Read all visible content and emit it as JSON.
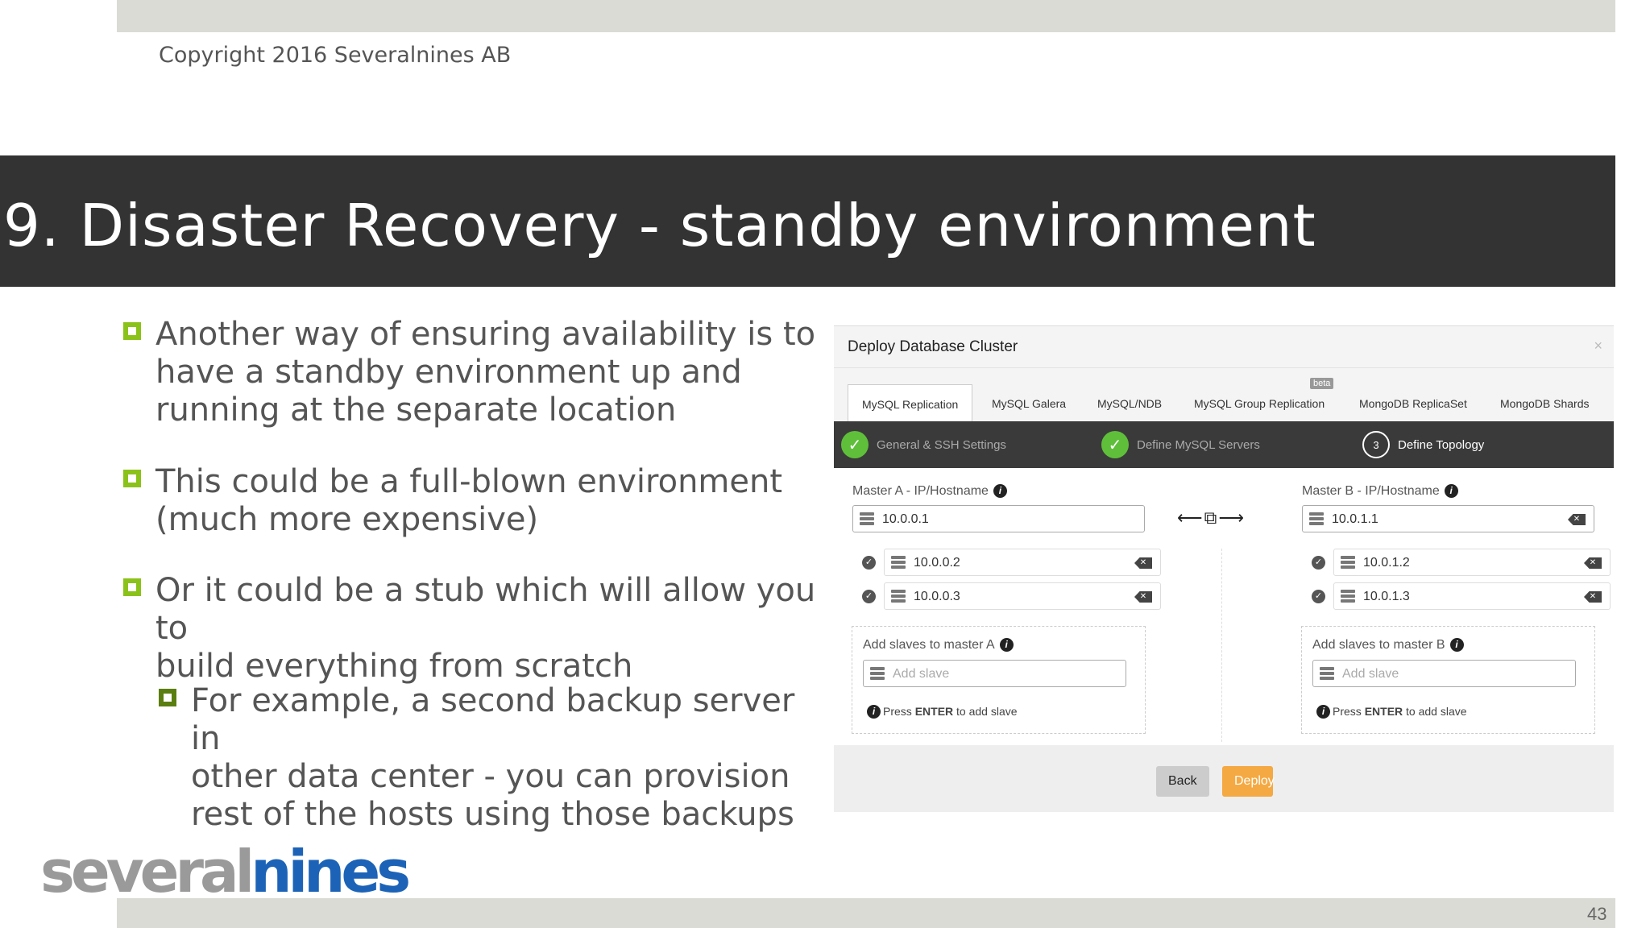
{
  "slide": {
    "copyright": "Copyright 2016 Severalnines AB",
    "title": "9. Disaster Recovery - standby environment",
    "page_number": "43",
    "logo_text_left": "several",
    "logo_text_right": "nines"
  },
  "bullets": [
    "Another way of ensuring availability is to\nhave a standby environment up and\nrunning at the separate location",
    "This could be a full-blown environment\n(much more expensive)",
    "Or it could be a stub which will allow you to\nbuild everything from scratch",
    "For example, a second backup server in\nother data center - you can provision\nrest of the hosts using those backups"
  ],
  "dialog": {
    "title": "Deploy Database Cluster",
    "close": "×",
    "tabs": [
      "MySQL Replication",
      "MySQL Galera",
      "MySQL/NDB",
      "MySQL Group Replication",
      "MongoDB ReplicaSet",
      "MongoDB Shards"
    ],
    "beta_badge": "beta",
    "steps": [
      {
        "label": "General & SSH Settings",
        "state": "done"
      },
      {
        "label": "Define MySQL Servers",
        "state": "done"
      },
      {
        "label": "Define Topology",
        "state": "current",
        "number": "3"
      }
    ],
    "master_a": {
      "label": "Master A - IP/Hostname",
      "value": "10.0.0.1",
      "slaves": [
        "10.0.0.2",
        "10.0.0.3"
      ],
      "add_label": "Add slaves to master A",
      "add_placeholder": "Add slave",
      "hint_prefix": "Press ",
      "hint_key": "ENTER",
      "hint_suffix": " to add slave"
    },
    "master_b": {
      "label": "Master B - IP/Hostname",
      "value": "10.0.1.1",
      "slaves": [
        "10.0.1.2",
        "10.0.1.3"
      ],
      "add_label": "Add slaves to master B",
      "add_placeholder": "Add slave",
      "hint_prefix": "Press ",
      "hint_key": "ENTER",
      "hint_suffix": " to add slave"
    },
    "buttons": {
      "back": "Back",
      "deploy": "Deploy"
    }
  },
  "colors": {
    "bullet": "#8bc21a",
    "title_bar": "#333333",
    "deploy": "#f5a942",
    "step_done": "#5fbf3a"
  }
}
